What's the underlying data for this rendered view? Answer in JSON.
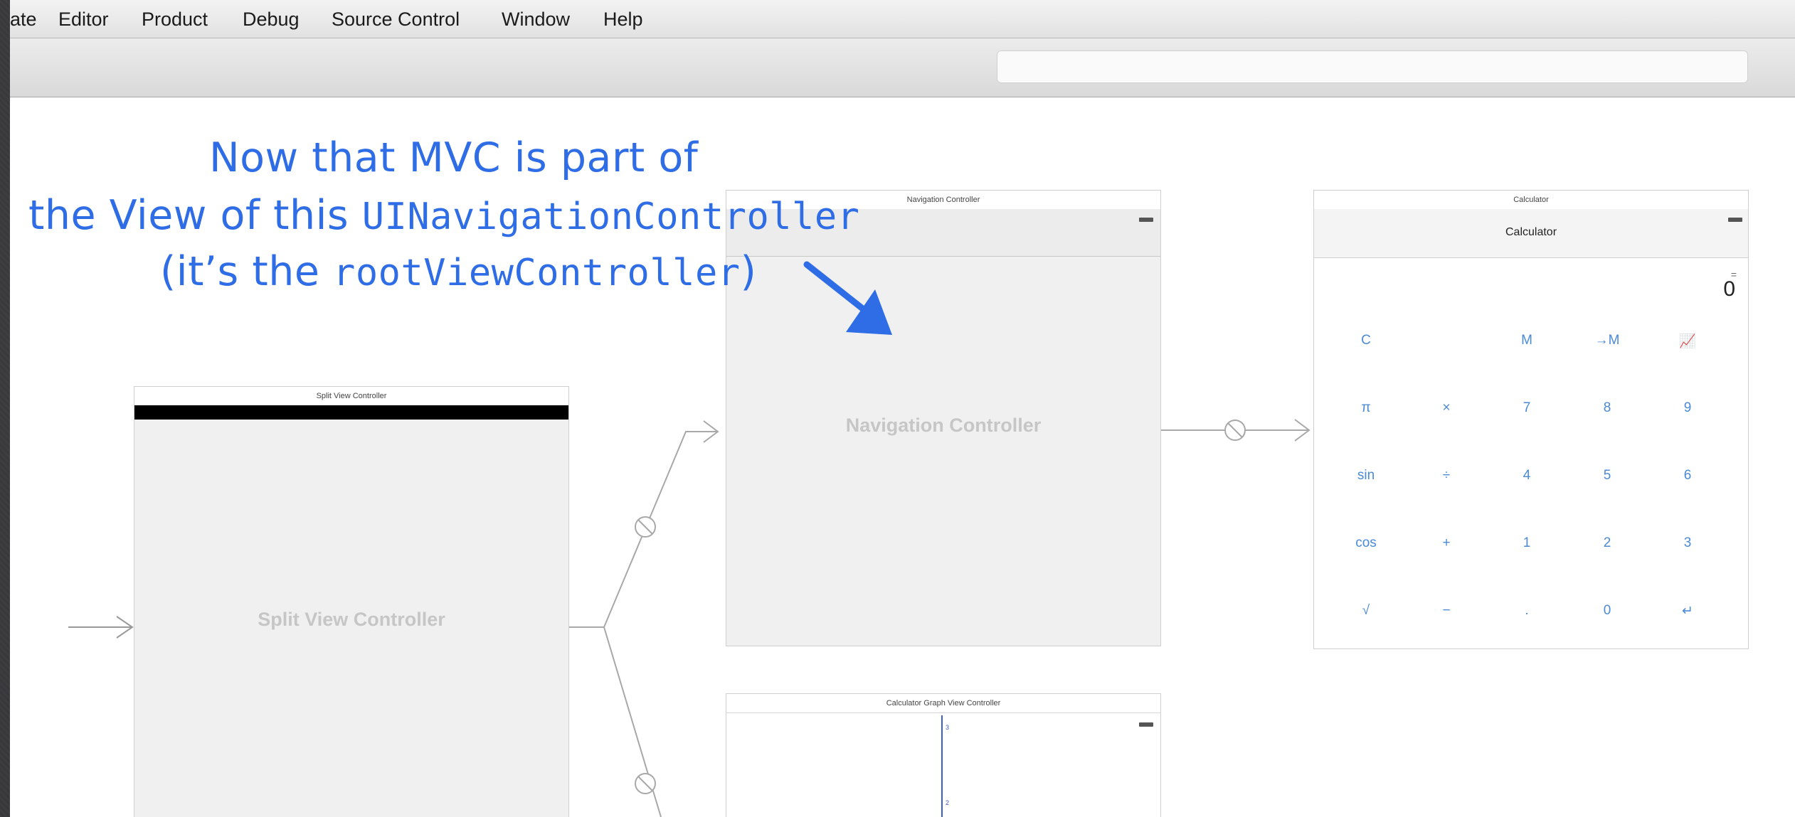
{
  "menu": {
    "items": [
      {
        "label": "ate"
      },
      {
        "label": "Editor"
      },
      {
        "label": "Product"
      },
      {
        "label": "Debug"
      },
      {
        "label": "Source Control"
      },
      {
        "label": "Window"
      },
      {
        "label": "Help"
      }
    ]
  },
  "annotation": {
    "line1": "Now that MVC is part of",
    "line2_prefix": "the View of this ",
    "line2_code": "UINavigationController",
    "line3_prefix": "(it’s the ",
    "line3_code": "rootViewController",
    "line3_suffix": ")",
    "color": "#2f6de6"
  },
  "scenes": {
    "split": {
      "title": "Split View Controller",
      "body": "Split View Controller"
    },
    "nav": {
      "title": "Navigation Controller",
      "body": "Navigation Controller"
    },
    "calc": {
      "title": "Calculator",
      "nav_title": "Calculator",
      "display_label": "=",
      "display_value": "0",
      "buttons": [
        [
          "C",
          "",
          "M",
          "→M",
          "📈"
        ],
        [
          "π",
          "×",
          "7",
          "8",
          "9"
        ],
        [
          "sin",
          "÷",
          "4",
          "5",
          "6"
        ],
        [
          "cos",
          "+",
          "1",
          "2",
          "3"
        ],
        [
          "√",
          "−",
          ".",
          "0",
          "↵"
        ]
      ]
    },
    "graph": {
      "title": "Calculator Graph View Controller",
      "tick_3": "3",
      "tick_2": "2"
    }
  },
  "icons": {
    "segue": "segue-icon",
    "arrow": "arrow-icon",
    "battery": "battery-icon"
  }
}
